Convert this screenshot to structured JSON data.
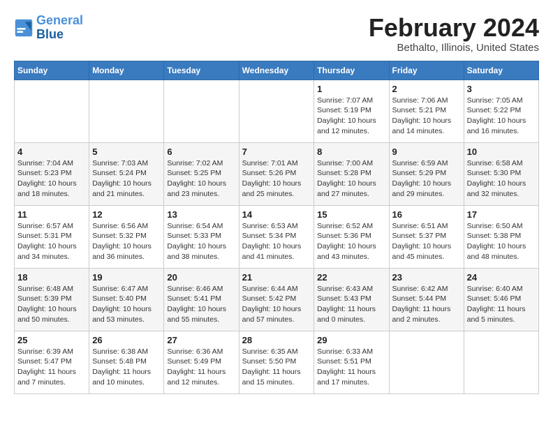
{
  "logo": {
    "line1": "General",
    "line2": "Blue"
  },
  "title": "February 2024",
  "subtitle": "Bethalto, Illinois, United States",
  "days_of_week": [
    "Sunday",
    "Monday",
    "Tuesday",
    "Wednesday",
    "Thursday",
    "Friday",
    "Saturday"
  ],
  "weeks": [
    [
      {
        "day": "",
        "info": ""
      },
      {
        "day": "",
        "info": ""
      },
      {
        "day": "",
        "info": ""
      },
      {
        "day": "",
        "info": ""
      },
      {
        "day": "1",
        "info": "Sunrise: 7:07 AM\nSunset: 5:19 PM\nDaylight: 10 hours\nand 12 minutes."
      },
      {
        "day": "2",
        "info": "Sunrise: 7:06 AM\nSunset: 5:21 PM\nDaylight: 10 hours\nand 14 minutes."
      },
      {
        "day": "3",
        "info": "Sunrise: 7:05 AM\nSunset: 5:22 PM\nDaylight: 10 hours\nand 16 minutes."
      }
    ],
    [
      {
        "day": "4",
        "info": "Sunrise: 7:04 AM\nSunset: 5:23 PM\nDaylight: 10 hours\nand 18 minutes."
      },
      {
        "day": "5",
        "info": "Sunrise: 7:03 AM\nSunset: 5:24 PM\nDaylight: 10 hours\nand 21 minutes."
      },
      {
        "day": "6",
        "info": "Sunrise: 7:02 AM\nSunset: 5:25 PM\nDaylight: 10 hours\nand 23 minutes."
      },
      {
        "day": "7",
        "info": "Sunrise: 7:01 AM\nSunset: 5:26 PM\nDaylight: 10 hours\nand 25 minutes."
      },
      {
        "day": "8",
        "info": "Sunrise: 7:00 AM\nSunset: 5:28 PM\nDaylight: 10 hours\nand 27 minutes."
      },
      {
        "day": "9",
        "info": "Sunrise: 6:59 AM\nSunset: 5:29 PM\nDaylight: 10 hours\nand 29 minutes."
      },
      {
        "day": "10",
        "info": "Sunrise: 6:58 AM\nSunset: 5:30 PM\nDaylight: 10 hours\nand 32 minutes."
      }
    ],
    [
      {
        "day": "11",
        "info": "Sunrise: 6:57 AM\nSunset: 5:31 PM\nDaylight: 10 hours\nand 34 minutes."
      },
      {
        "day": "12",
        "info": "Sunrise: 6:56 AM\nSunset: 5:32 PM\nDaylight: 10 hours\nand 36 minutes."
      },
      {
        "day": "13",
        "info": "Sunrise: 6:54 AM\nSunset: 5:33 PM\nDaylight: 10 hours\nand 38 minutes."
      },
      {
        "day": "14",
        "info": "Sunrise: 6:53 AM\nSunset: 5:34 PM\nDaylight: 10 hours\nand 41 minutes."
      },
      {
        "day": "15",
        "info": "Sunrise: 6:52 AM\nSunset: 5:36 PM\nDaylight: 10 hours\nand 43 minutes."
      },
      {
        "day": "16",
        "info": "Sunrise: 6:51 AM\nSunset: 5:37 PM\nDaylight: 10 hours\nand 45 minutes."
      },
      {
        "day": "17",
        "info": "Sunrise: 6:50 AM\nSunset: 5:38 PM\nDaylight: 10 hours\nand 48 minutes."
      }
    ],
    [
      {
        "day": "18",
        "info": "Sunrise: 6:48 AM\nSunset: 5:39 PM\nDaylight: 10 hours\nand 50 minutes."
      },
      {
        "day": "19",
        "info": "Sunrise: 6:47 AM\nSunset: 5:40 PM\nDaylight: 10 hours\nand 53 minutes."
      },
      {
        "day": "20",
        "info": "Sunrise: 6:46 AM\nSunset: 5:41 PM\nDaylight: 10 hours\nand 55 minutes."
      },
      {
        "day": "21",
        "info": "Sunrise: 6:44 AM\nSunset: 5:42 PM\nDaylight: 10 hours\nand 57 minutes."
      },
      {
        "day": "22",
        "info": "Sunrise: 6:43 AM\nSunset: 5:43 PM\nDaylight: 11 hours\nand 0 minutes."
      },
      {
        "day": "23",
        "info": "Sunrise: 6:42 AM\nSunset: 5:44 PM\nDaylight: 11 hours\nand 2 minutes."
      },
      {
        "day": "24",
        "info": "Sunrise: 6:40 AM\nSunset: 5:46 PM\nDaylight: 11 hours\nand 5 minutes."
      }
    ],
    [
      {
        "day": "25",
        "info": "Sunrise: 6:39 AM\nSunset: 5:47 PM\nDaylight: 11 hours\nand 7 minutes."
      },
      {
        "day": "26",
        "info": "Sunrise: 6:38 AM\nSunset: 5:48 PM\nDaylight: 11 hours\nand 10 minutes."
      },
      {
        "day": "27",
        "info": "Sunrise: 6:36 AM\nSunset: 5:49 PM\nDaylight: 11 hours\nand 12 minutes."
      },
      {
        "day": "28",
        "info": "Sunrise: 6:35 AM\nSunset: 5:50 PM\nDaylight: 11 hours\nand 15 minutes."
      },
      {
        "day": "29",
        "info": "Sunrise: 6:33 AM\nSunset: 5:51 PM\nDaylight: 11 hours\nand 17 minutes."
      },
      {
        "day": "",
        "info": ""
      },
      {
        "day": "",
        "info": ""
      }
    ]
  ]
}
